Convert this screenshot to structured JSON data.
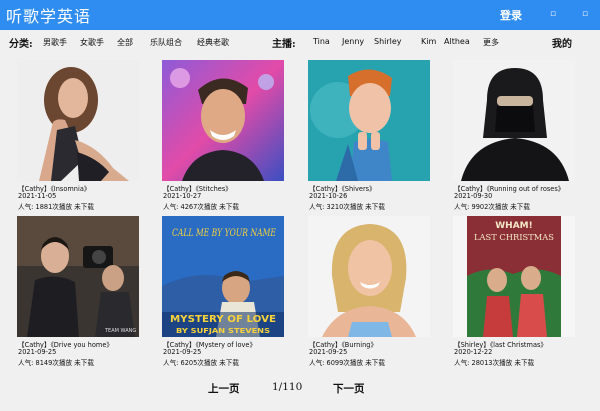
{
  "window": {
    "title": "听歌学英语",
    "login_label": "登录",
    "minimize_glyph": "▫",
    "close_glyph": "▫"
  },
  "filters": {
    "category_label": "分类:",
    "categories": [
      "男歌手",
      "女歌手",
      "全部",
      "乐队组合",
      "经典老歌"
    ],
    "anchor_label": "主播:",
    "anchors": [
      "Tina",
      "Jenny",
      "Shirley",
      "Kim",
      "Althea",
      "更多"
    ],
    "mine_label": "我的"
  },
  "songs": [
    {
      "title": "【Cathy】《Insomnia》",
      "date": "2021-11-05",
      "stats": "人气: 1881次播放   未下载",
      "thumb": "portrait-woman-brown-hair"
    },
    {
      "title": "【Cathy】《Stitches》",
      "date": "2021-10-27",
      "stats": "人气: 4267次播放   未下载",
      "thumb": "portrait-man-pink-stage"
    },
    {
      "title": "【Cathy】《Shivers》",
      "date": "2021-10-26",
      "stats": "人气: 3210次播放   未下载",
      "thumb": "portrait-red-hair-teal"
    },
    {
      "title": "【Cathy】《Running out of roses》",
      "date": "2021-09-30",
      "stats": "人气: 9902次播放   未下载",
      "thumb": "portrait-masked-hoodie"
    },
    {
      "title": "【Cathy】《Drive you home》",
      "date": "2021-09-25",
      "stats": "人气: 8149次播放   未下载",
      "thumb": "film-still-crew"
    },
    {
      "title": "【Cathy】《Mystery of love》",
      "date": "2021-09-25",
      "stats": "人气: 6205次播放   未下载",
      "thumb": "album-call-me-by-your-name"
    },
    {
      "title": "【Cathy】《Burning》",
      "date": "2021-09-25",
      "stats": "人气: 6099次播放   未下载",
      "thumb": "portrait-blonde-woman"
    },
    {
      "title": "【Shirley】《last Christmas》",
      "date": "2020-12-22",
      "stats": "人气: 28013次播放   未下载",
      "thumb": "album-wham-last-christmas"
    }
  ],
  "album_text": {
    "album6_top": "CALL ME BY YOUR NAME",
    "album6_bottom1": "MYSTERY OF LOVE",
    "album6_bottom2": "BY SUFJAN STEVENS",
    "album8_top1": "WHAM!",
    "album8_top2": "LAST CHRISTMAS",
    "album5_logo": "TEAM WANG"
  },
  "pager": {
    "prev_label": "上一页",
    "page_indicator": "1/110",
    "next_label": "下一页"
  },
  "colors": {
    "titlebar": "#2f8df2",
    "background": "#f0f0f0"
  }
}
